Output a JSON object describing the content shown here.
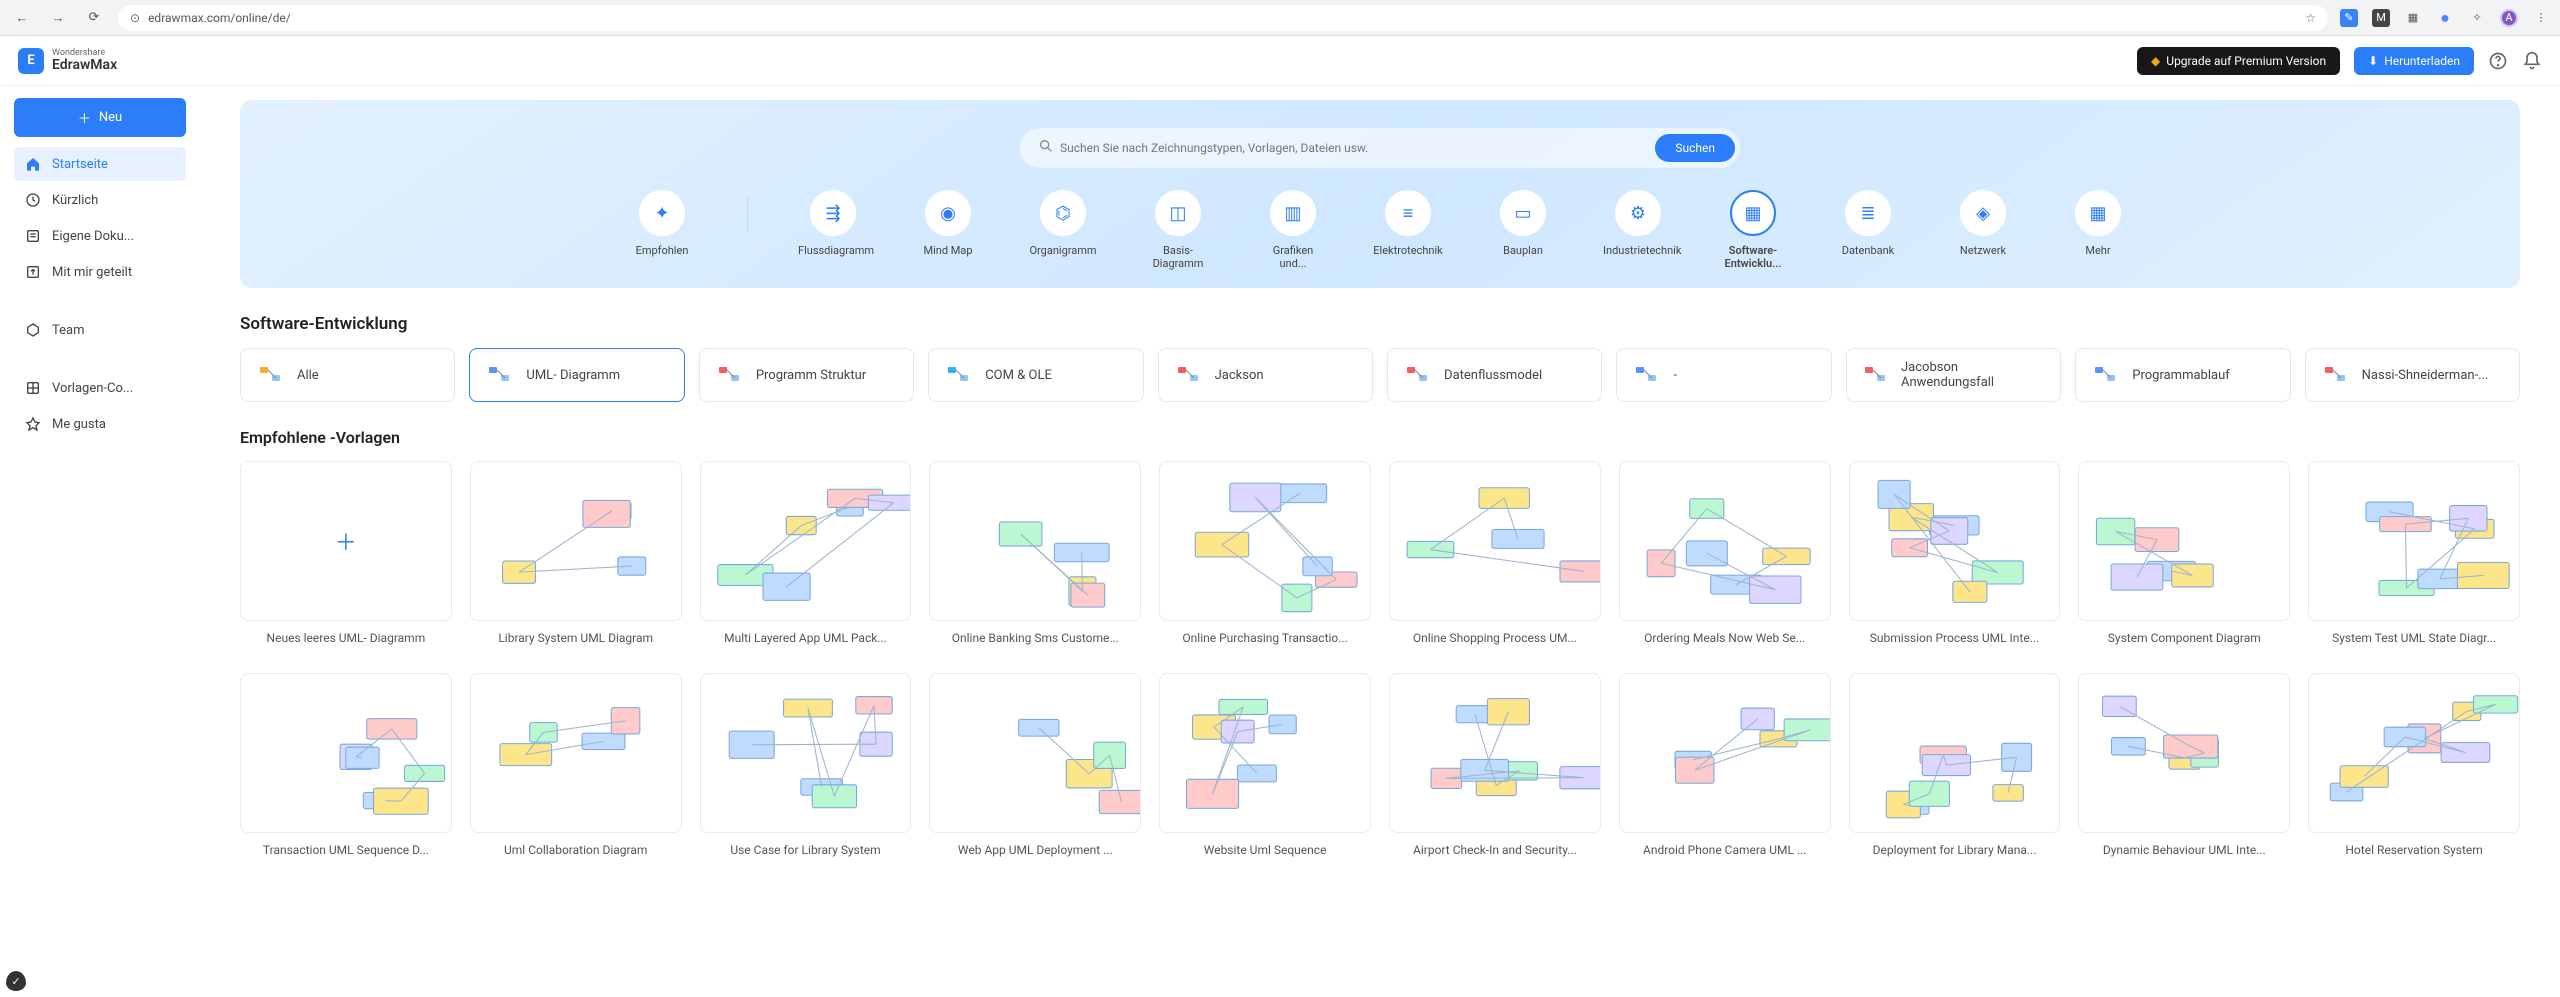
{
  "browser": {
    "url": "edrawmax.com/online/de/"
  },
  "logo": {
    "sub": "Wondershare",
    "main": "EdrawMax"
  },
  "appbar": {
    "upgrade": "Upgrade auf Premium Version",
    "download": "Herunterladen"
  },
  "neu_button": "Neu",
  "sidebar": [
    {
      "name": "startseite",
      "label": "Startseite",
      "icon": "home",
      "active": true
    },
    {
      "name": "kuerzlich",
      "label": "Kürzlich",
      "icon": "clock",
      "active": false
    },
    {
      "name": "eigene",
      "label": "Eigene Doku...",
      "icon": "doc",
      "active": false
    },
    {
      "name": "geteilt",
      "label": "Mit mir geteilt",
      "icon": "share",
      "active": false
    },
    {
      "name": "team",
      "label": "Team",
      "icon": "team",
      "active": false
    },
    {
      "name": "vorlagen",
      "label": "Vorlagen-Co...",
      "icon": "grid",
      "active": false
    },
    {
      "name": "megusta",
      "label": "Me gusta",
      "icon": "star",
      "active": false
    }
  ],
  "search": {
    "placeholder": "Suchen Sie nach Zeichnungstypen, Vorlagen, Dateien usw.",
    "button": "Suchen"
  },
  "categories": [
    {
      "name": "empfohlen",
      "label": "Empfohlen",
      "active": false
    },
    {
      "name": "flussdiagramm",
      "label": "Flussdiagramm",
      "active": false
    },
    {
      "name": "mindmap",
      "label": "Mind Map",
      "active": false
    },
    {
      "name": "organigramm",
      "label": "Organigramm",
      "active": false
    },
    {
      "name": "basis",
      "label": "Basis-Diagramm",
      "active": false
    },
    {
      "name": "grafiken",
      "label": "Grafiken und...",
      "active": false
    },
    {
      "name": "elektro",
      "label": "Elektrotechnik",
      "active": false
    },
    {
      "name": "bauplan",
      "label": "Bauplan",
      "active": false
    },
    {
      "name": "industrie",
      "label": "Industrietechnik",
      "active": false
    },
    {
      "name": "software",
      "label": "Software-Entwicklu...",
      "active": true
    },
    {
      "name": "datenbank",
      "label": "Datenbank",
      "active": false
    },
    {
      "name": "netzwerk",
      "label": "Netzwerk",
      "active": false
    },
    {
      "name": "mehr",
      "label": "Mehr",
      "active": false
    }
  ],
  "section_title": "Software-Entwicklung",
  "tabs": [
    {
      "name": "alle",
      "label": "Alle",
      "active": false
    },
    {
      "name": "uml",
      "label": "UML- Diagramm",
      "active": true
    },
    {
      "name": "programm",
      "label": "Programm Struktur",
      "active": false
    },
    {
      "name": "com",
      "label": "COM & OLE",
      "active": false
    },
    {
      "name": "jackson",
      "label": "Jackson",
      "active": false
    },
    {
      "name": "datenfluss",
      "label": "Datenflussmodel",
      "active": false
    },
    {
      "name": "dash",
      "label": "-",
      "active": false
    },
    {
      "name": "jacobson",
      "label": "Jacobson Anwendungsfall",
      "active": false
    },
    {
      "name": "programmablauf",
      "label": "Programmablauf",
      "active": false
    },
    {
      "name": "nassi",
      "label": "Nassi-Shneiderman-...",
      "active": false
    }
  ],
  "templates_title": "Empfohlene -Vorlagen",
  "templates_row1": [
    {
      "name": "new-blank",
      "label": "Neues leeres UML- Diagramm",
      "new": true
    },
    {
      "name": "t1",
      "label": "Library System UML Diagram"
    },
    {
      "name": "t2",
      "label": "Multi Layered App UML Pack..."
    },
    {
      "name": "t3",
      "label": "Online Banking Sms Custome..."
    },
    {
      "name": "t4",
      "label": "Online Purchasing Transactio..."
    },
    {
      "name": "t5",
      "label": "Online Shopping Process UM..."
    },
    {
      "name": "t6",
      "label": "Ordering Meals Now Web Se..."
    },
    {
      "name": "t7",
      "label": "Submission Process UML Inte..."
    },
    {
      "name": "t8",
      "label": "System Component Diagram"
    },
    {
      "name": "t9",
      "label": "System Test UML State Diagr..."
    }
  ],
  "templates_row2": [
    {
      "name": "t10",
      "label": "Transaction UML Sequence D..."
    },
    {
      "name": "t11",
      "label": "Uml Collaboration Diagram"
    },
    {
      "name": "t12",
      "label": "Use Case for Library System"
    },
    {
      "name": "t13",
      "label": "Web App UML Deployment ..."
    },
    {
      "name": "t14",
      "label": "Website Uml Sequence"
    },
    {
      "name": "t15",
      "label": "Airport Check-In and Security..."
    },
    {
      "name": "t16",
      "label": "Android Phone Camera UML ..."
    },
    {
      "name": "t17",
      "label": "Deployment for Library Mana..."
    },
    {
      "name": "t18",
      "label": "Dynamic Behaviour UML Inte..."
    },
    {
      "name": "t19",
      "label": "Hotel Reservation System"
    }
  ]
}
